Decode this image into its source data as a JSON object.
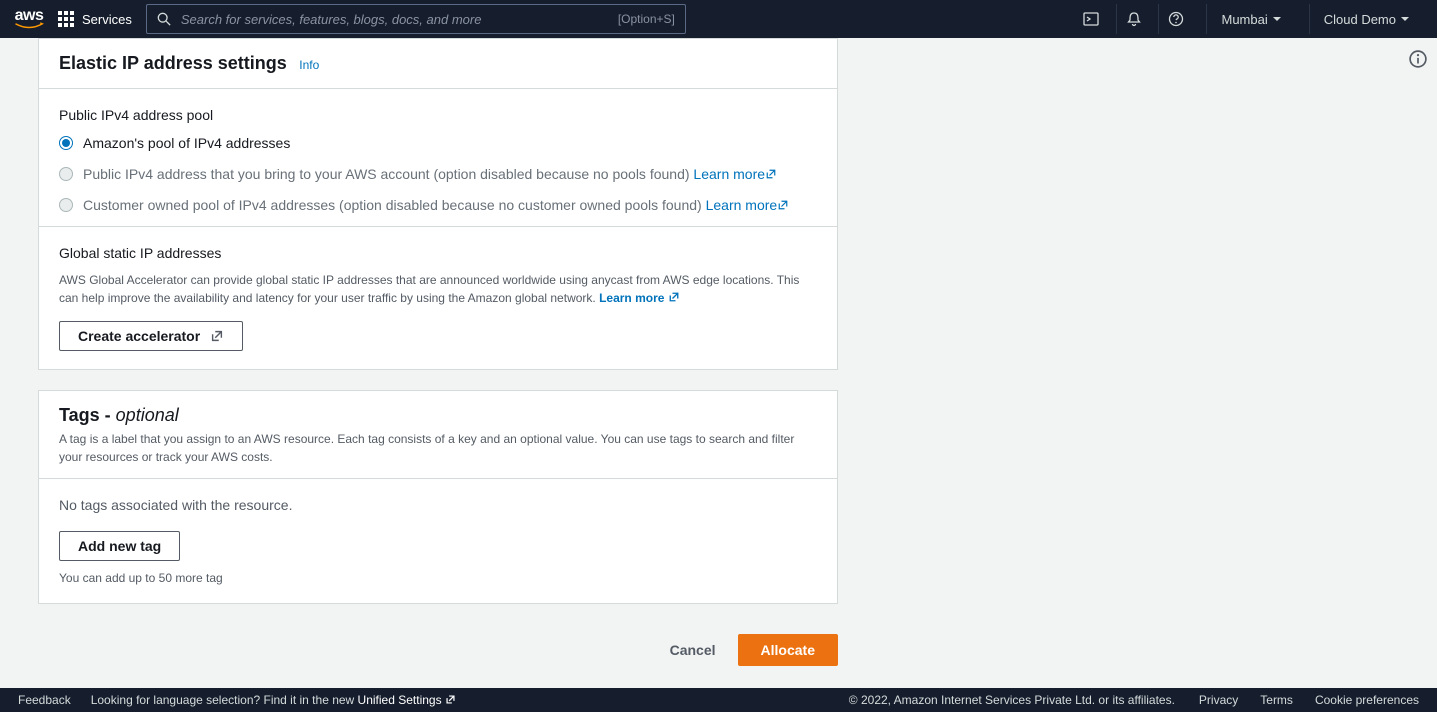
{
  "nav": {
    "logo": "aws",
    "services_label": "Services",
    "search_placeholder": "Search for services, features, blogs, docs, and more",
    "search_shortcut": "[Option+S]",
    "region": "Mumbai",
    "account": "Cloud Demo"
  },
  "eip": {
    "title": "Elastic IP address settings",
    "info_link": "Info",
    "pool_heading": "Public IPv4 address pool",
    "opt1": "Amazon's pool of IPv4 addresses",
    "opt2": "Public IPv4 address that you bring to your AWS account (option disabled because no pools found) ",
    "opt3": "Customer owned pool of IPv4 addresses (option disabled because no customer owned pools found) ",
    "learn_more": "Learn more",
    "global_heading": "Global static IP addresses",
    "global_desc": "AWS Global Accelerator can provide global static IP addresses that are announced worldwide using anycast from AWS edge locations. This can help improve the availability and latency for your user traffic by using the Amazon global network. ",
    "create_accel": "Create accelerator"
  },
  "tags": {
    "title": "Tags - ",
    "optional": "optional",
    "desc": "A tag is a label that you assign to an AWS resource. Each tag consists of a key and an optional value. You can use tags to search and filter your resources or track your AWS costs.",
    "empty": "No tags associated with the resource.",
    "add_btn": "Add new tag",
    "hint": "You can add up to 50 more tag"
  },
  "actions": {
    "cancel": "Cancel",
    "allocate": "Allocate"
  },
  "footer": {
    "feedback": "Feedback",
    "lang_text": "Looking for language selection? Find it in the new ",
    "unified": "Unified Settings",
    "copyright": "© 2022, Amazon Internet Services Private Ltd. or its affiliates.",
    "privacy": "Privacy",
    "terms": "Terms",
    "cookies": "Cookie preferences"
  }
}
